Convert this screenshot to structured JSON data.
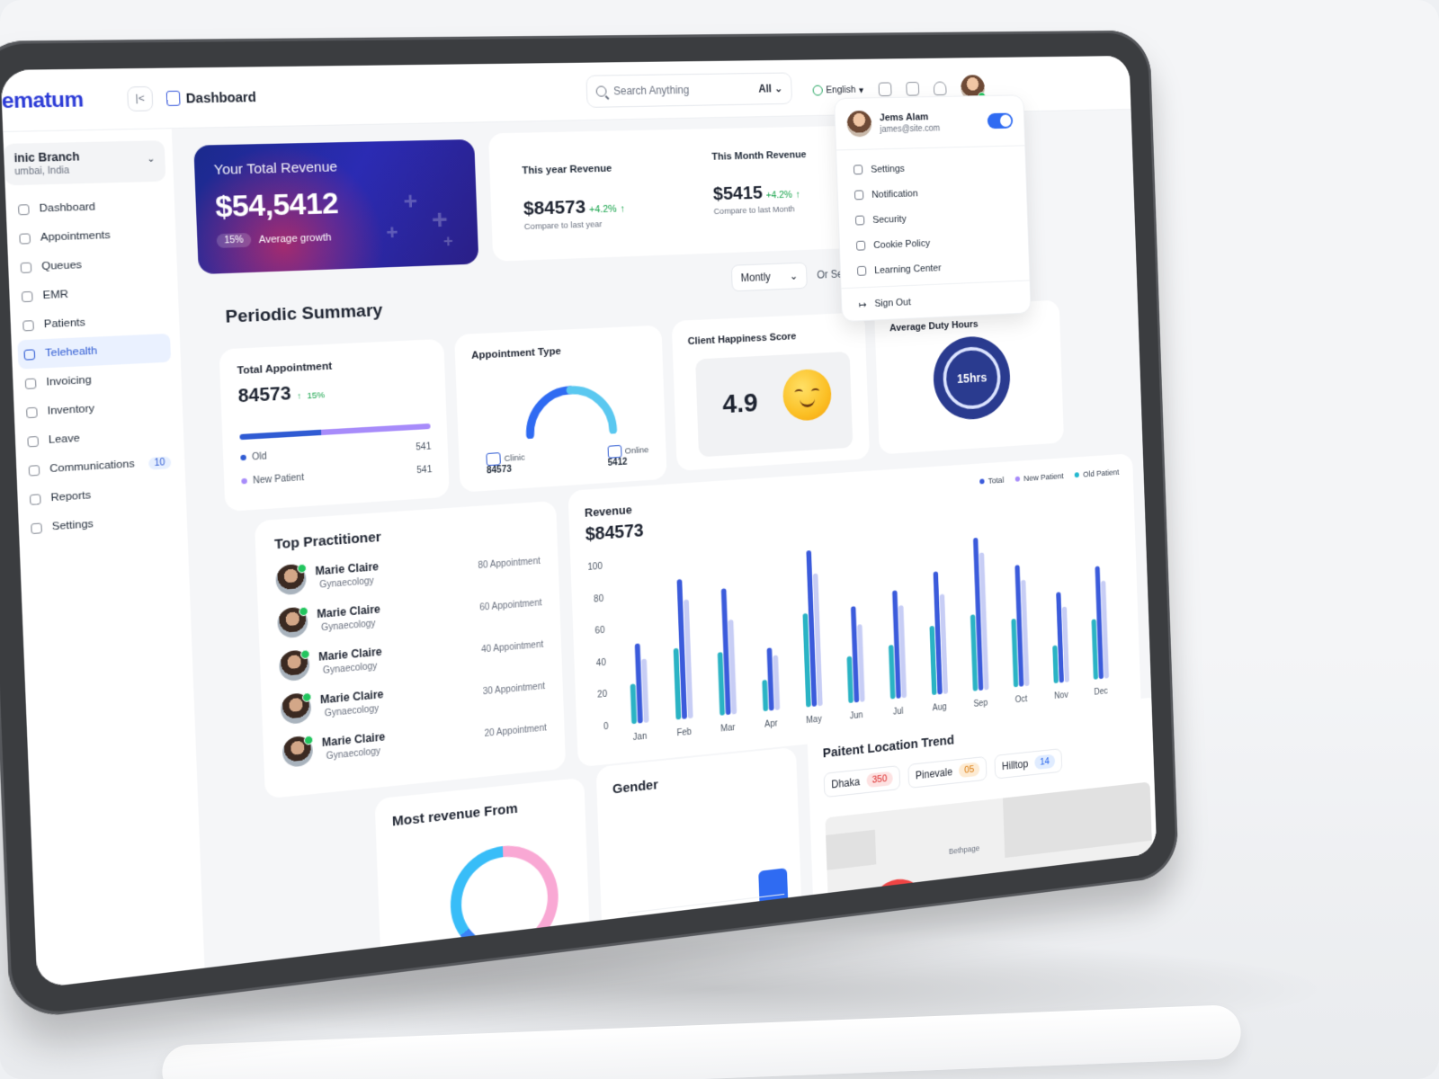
{
  "app": {
    "logo": "ematum",
    "breadcrumb": "Dashboard"
  },
  "search": {
    "placeholder": "Search Anything",
    "scope": "All"
  },
  "header": {
    "language": "English"
  },
  "branch": {
    "name": "inic Branch",
    "location": "umbai, India"
  },
  "sidebar": {
    "items": [
      {
        "label": "Dashboard"
      },
      {
        "label": "Appointments"
      },
      {
        "label": "Queues"
      },
      {
        "label": "EMR"
      },
      {
        "label": "Patients"
      },
      {
        "label": "Telehealth",
        "active": true
      },
      {
        "label": "Invoicing"
      },
      {
        "label": "Inventory"
      },
      {
        "label": "Leave"
      },
      {
        "label": "Communications",
        "count": "10"
      },
      {
        "label": "Reports"
      },
      {
        "label": "Settings"
      }
    ]
  },
  "hero": {
    "title": "Your Total Revenue",
    "value": "$54,5412",
    "pill": "15%",
    "growth_label": "Average growth"
  },
  "revenue_pair": {
    "year": {
      "label": "This year Revenue",
      "value": "$84573",
      "pct": "+4.2%",
      "compare": "Compare to last year"
    },
    "month": {
      "label": "This Month Revenue",
      "value": "$5415",
      "pct": "+4.2%",
      "compare": "Compare to last Month"
    }
  },
  "filter": {
    "period": "Montly",
    "or_select": "Or Selec"
  },
  "periodic_summary": {
    "title": "Periodic Summary"
  },
  "total_appointment": {
    "label": "Total Appointment",
    "value": "84573",
    "pct": "15%",
    "old": {
      "label": "Old",
      "value": "541"
    },
    "new": {
      "label": "New Patient",
      "value": "541"
    },
    "old_share": 0.42
  },
  "appointment_type": {
    "label": "Appointment Type",
    "clinic": {
      "label": "Clinic",
      "value": "84573"
    },
    "online": {
      "label": "Online",
      "value": "5412"
    }
  },
  "happiness": {
    "label": "Client Happiness Score",
    "value": "4.9"
  },
  "duty": {
    "label": "Average Duty Hours",
    "value": "15hrs"
  },
  "top_practitioner": {
    "title": "Top Practitioner",
    "rows": [
      {
        "name": "Marie Claire",
        "spec": "Gynaecology",
        "count": "80 Appointment"
      },
      {
        "name": "Marie Claire",
        "spec": "Gynaecology",
        "count": "60 Appointment"
      },
      {
        "name": "Marie Claire",
        "spec": "Gynaecology",
        "count": "40 Appointment"
      },
      {
        "name": "Marie Claire",
        "spec": "Gynaecology",
        "count": "30 Appointment"
      },
      {
        "name": "Marie Claire",
        "spec": "Gynaecology",
        "count": "20 Appointment"
      }
    ]
  },
  "revenue_chart": {
    "title": "Revenue",
    "total": "$84573",
    "legend": [
      {
        "name": "Total",
        "color": "#3b5bdb"
      },
      {
        "name": "New Patient",
        "color": "#a78bfa"
      },
      {
        "name": "Old Patient",
        "color": "#22b8cf"
      }
    ]
  },
  "chart_data": {
    "type": "bar",
    "categories": [
      "Jan",
      "Feb",
      "Mar",
      "Apr",
      "May",
      "Jun",
      "Jul",
      "Aug",
      "Sep",
      "Oct",
      "Nov",
      "Dec"
    ],
    "yticks": [
      "0",
      "20",
      "40",
      "60",
      "80",
      "100"
    ],
    "ylim": [
      0,
      100
    ],
    "series": [
      {
        "name": "Total",
        "color": "#3b5bdb",
        "values": [
          50,
          88,
          80,
          40,
          100,
          62,
          70,
          80,
          100,
          80,
          60,
          75
        ]
      },
      {
        "name": "New Patient",
        "color": "#c7cdf5",
        "values": [
          40,
          75,
          60,
          35,
          85,
          50,
          60,
          65,
          90,
          70,
          50,
          65
        ]
      },
      {
        "name": "Old Patient",
        "color": "#2ab3c4",
        "values": [
          25,
          45,
          40,
          20,
          60,
          30,
          35,
          45,
          50,
          45,
          25,
          40
        ]
      }
    ]
  },
  "most_revenue": {
    "title": "Most revenue From"
  },
  "gender": {
    "title": "Gender"
  },
  "location_trend": {
    "title": "Paitent Location Trend",
    "chips": [
      {
        "name": "Dhaka",
        "value": "350",
        "bg": "#fde2e2",
        "fg": "#dc2626"
      },
      {
        "name": "Pinevale",
        "value": "05",
        "bg": "#fdebd3",
        "fg": "#d97706"
      },
      {
        "name": "Hilltop",
        "value": "14",
        "bg": "#e0ecff",
        "fg": "#2563eb"
      }
    ],
    "map_label": "Bethpage"
  },
  "profile_menu": {
    "name": "Jems Alam",
    "email": "james@site.com",
    "items": [
      "Settings",
      "Notification",
      "Security",
      "Cookie Policy",
      "Learning Center"
    ],
    "signout": "Sign Out"
  }
}
